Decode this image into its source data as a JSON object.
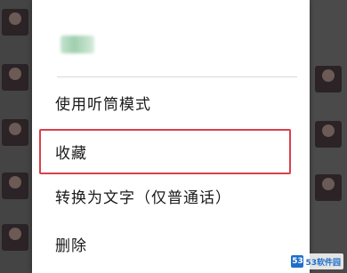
{
  "menu": {
    "items": [
      {
        "label": "使用听筒模式"
      },
      {
        "label": "收藏"
      },
      {
        "label": "转换为文字（仅普通话）"
      },
      {
        "label": "删除"
      }
    ],
    "highlighted_index": 1
  },
  "watermark": {
    "logo_text": "53",
    "text": "53软件园"
  },
  "colors": {
    "highlight_border": "#d9404b",
    "menu_background": "#ffffff",
    "overlay": "#4b4b4b"
  }
}
